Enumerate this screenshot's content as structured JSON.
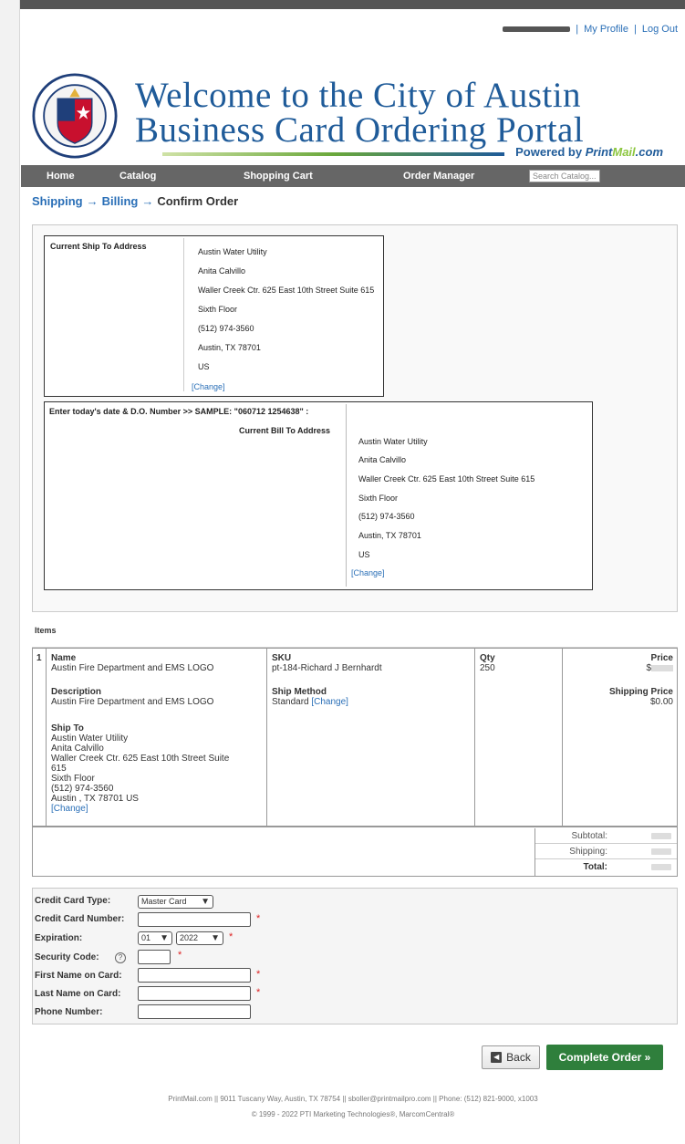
{
  "header": {
    "links": {
      "profile": "My Profile",
      "logout": "Log Out",
      "separator": "|"
    },
    "title_line1": "Welcome to the City of Austin",
    "title_line2": "Business Card Ordering Portal",
    "powered_prefix": "Powered by",
    "powered_brand_a": "Print",
    "powered_brand_b": "Mail",
    "powered_brand_c": ".com"
  },
  "nav": {
    "home": "Home",
    "catalog": "Catalog",
    "cart": "Shopping Cart",
    "orders": "Order Manager",
    "search_placeholder": "Search Catalog..."
  },
  "steps": {
    "shipping": "Shipping",
    "billing": "Billing",
    "confirm": "Confirm Order",
    "arrow": "→"
  },
  "ship_to": {
    "label": "Current Ship To Address",
    "lines": [
      "Austin Water Utility",
      "Anita Calvillo",
      "Waller Creek Ctr. 625 East 10th Street Suite 615",
      "Sixth Floor",
      "(512) 974-3560",
      "Austin, TX 78701",
      "US"
    ],
    "change": "[Change]"
  },
  "bill_to": {
    "po_label": "Enter today's date & D.O. Number >> SAMPLE: \"060712 1254638\" :",
    "label": "Current Bill To Address",
    "lines": [
      "Austin Water Utility",
      "Anita Calvillo",
      "Waller Creek Ctr. 625 East 10th Street Suite 615",
      "Sixth Floor",
      "(512) 974-3560",
      "Austin, TX 78701",
      "US"
    ],
    "change": "[Change]"
  },
  "items": {
    "label": "Items",
    "row": {
      "index": "1",
      "name_label": "Name",
      "name": "Austin Fire Department and EMS LOGO",
      "desc_label": "Description",
      "desc": "Austin Fire Department and EMS LOGO",
      "shipto_label": "Ship To",
      "shipto_lines": [
        "Austin Water Utility",
        "Anita Calvillo",
        "Waller Creek Ctr. 625 East 10th Street Suite",
        "615",
        "Sixth Floor",
        "(512) 974-3560",
        "Austin , TX 78701 US"
      ],
      "shipto_change": "[Change]",
      "sku_label": "SKU",
      "sku": "pt-184-Richard J Bernhardt",
      "method_label": "Ship Method",
      "method": "Standard",
      "method_change": "[Change]",
      "qty_label": "Qty",
      "qty": "250",
      "price_label": "Price",
      "price_prefix": "$",
      "ship_price_label": "Shipping Price",
      "ship_price": "$0.00"
    }
  },
  "totals": {
    "subtotal": "Subtotal:",
    "shipping": "Shipping:",
    "total": "Total:"
  },
  "payment": {
    "type_label": "Credit Card Type:",
    "type_value": "Master Card",
    "number_label": "Credit Card Number:",
    "exp_label": "Expiration:",
    "exp_month": "01",
    "exp_year": "2022",
    "security_label": "Security Code:",
    "first_label": "First Name on Card:",
    "last_label": "Last Name on Card:",
    "phone_label": "Phone Number:",
    "required_mark": "*"
  },
  "actions": {
    "back": "Back",
    "complete": "Complete Order »"
  },
  "footer": {
    "line1": "PrintMail.com || 9011 Tuscany Way, Austin, TX 78754 || sboller@printmailpro.com || Phone: (512) 821-9000, x1003",
    "line2": "© 1999 - 2022 PTI Marketing Technologies®, MarcomCentral®"
  }
}
